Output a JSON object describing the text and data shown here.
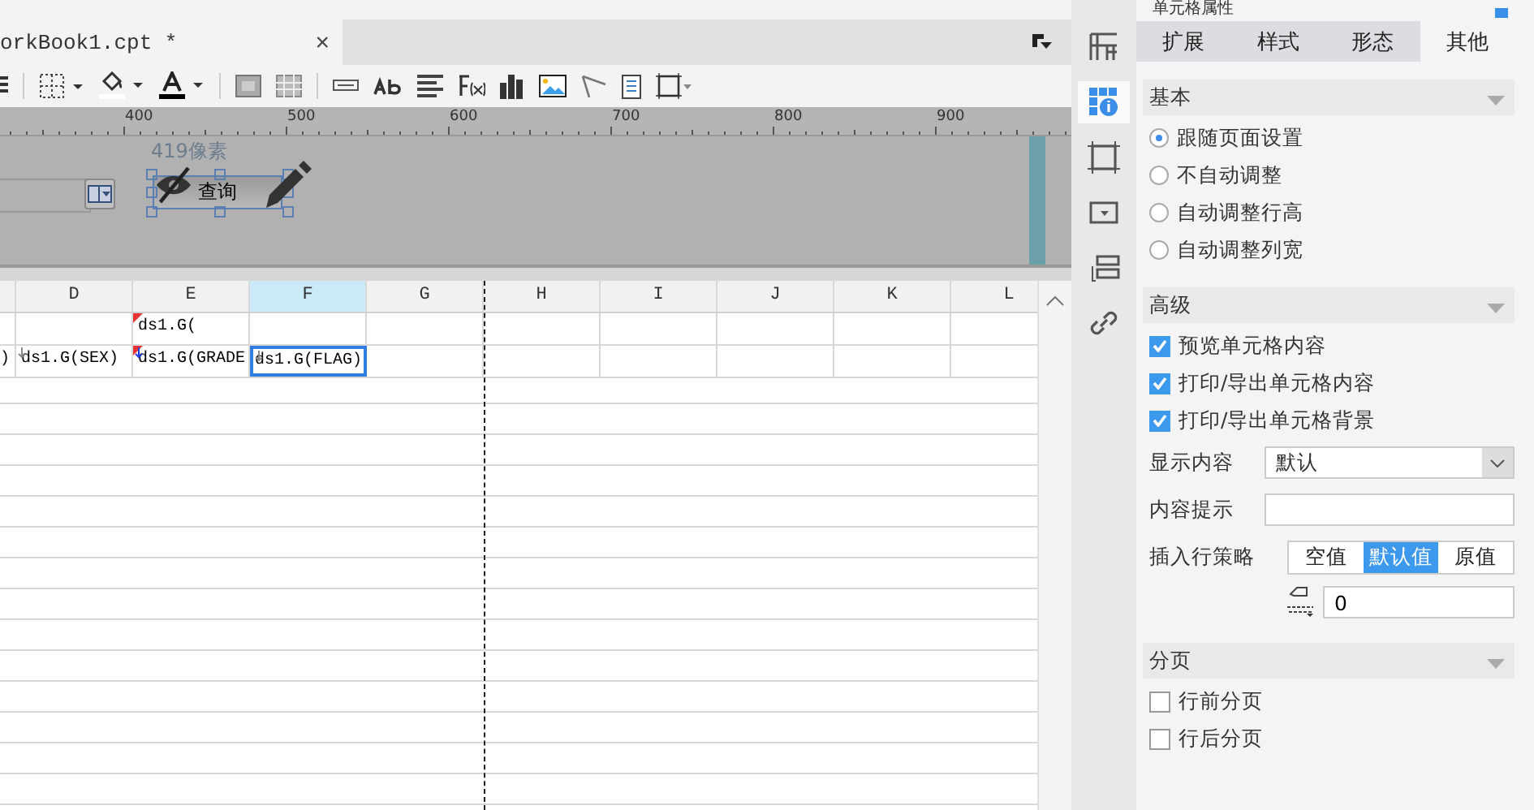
{
  "editor_tab": {
    "title": "orkBook1.cpt *",
    "close": "×"
  },
  "ruler": {
    "labels": [
      "400",
      "500",
      "600",
      "700",
      "800",
      "900"
    ]
  },
  "canvas": {
    "size_label": "419像素",
    "button_label": "查询"
  },
  "grid": {
    "columns": [
      {
        "selected": false
      },
      {
        "label": "D",
        "selected": false
      },
      {
        "label": "E",
        "selected": false
      },
      {
        "label": "F",
        "selected": true
      },
      {
        "label": "G",
        "selected": false
      },
      {
        "label": "H",
        "selected": false
      },
      {
        "label": "I",
        "selected": false
      },
      {
        "label": "J",
        "selected": false
      },
      {
        "label": "K",
        "selected": false
      },
      {
        "label": "L",
        "selected": false
      }
    ],
    "rows": [
      {
        "cells": [
          {
            "selected": false
          },
          {
            "selected": false
          },
          {
            "text": "ds1.G(",
            "kind": "flag",
            "selected": false
          }
        ]
      },
      {
        "cells": [
          {
            "text": ")",
            "selected": false
          },
          {
            "text": "ds1.G(SEX)",
            "kind": "arrow",
            "selected": false
          },
          {
            "text": "ds1.G(GRADE",
            "kind": "flag-arrow",
            "selected": false
          },
          {
            "text": "ds1.G(FLAG)",
            "kind": "arrow",
            "selected": true
          }
        ]
      }
    ]
  },
  "side_icons": [
    {
      "kind": "layout",
      "selected": false
    },
    {
      "kind": "cell-info",
      "selected": true
    },
    {
      "kind": "frame",
      "selected": false
    },
    {
      "kind": "dropdown",
      "selected": false
    },
    {
      "kind": "list",
      "selected": false
    },
    {
      "kind": "link",
      "selected": false
    }
  ],
  "panel": {
    "title": "单元格属性",
    "tabs": [
      {
        "label": "扩展",
        "selected": false
      },
      {
        "label": "样式",
        "selected": false
      },
      {
        "label": "形态",
        "selected": false
      },
      {
        "label": "其他",
        "selected": true
      }
    ],
    "sections": [
      {
        "title": "基本",
        "items": [
          {
            "kind": "radio",
            "label": "跟随页面设置",
            "selected": true
          },
          {
            "kind": "radio",
            "label": "不自动调整",
            "selected": false
          },
          {
            "kind": "radio",
            "label": "自动调整行高",
            "selected": false
          },
          {
            "kind": "radio",
            "label": "自动调整列宽",
            "selected": false
          }
        ]
      },
      {
        "title": "高级",
        "items": [
          {
            "kind": "checkbox",
            "label": "预览单元格内容",
            "checked": true
          },
          {
            "kind": "checkbox",
            "label": "打印/导出单元格内容",
            "checked": true
          },
          {
            "kind": "checkbox",
            "label": "打印/导出单元格背景",
            "checked": true
          },
          {
            "kind": "select",
            "label": "显示内容",
            "value": "默认"
          },
          {
            "kind": "text",
            "label": "内容提示"
          },
          {
            "kind": "segmented",
            "label": "插入行策略",
            "options": [
              {
                "label": "空值",
                "selected": false
              },
              {
                "label": "默认值",
                "selected": true
              },
              {
                "label": "原值",
                "selected": false
              }
            ]
          },
          {
            "kind": "value",
            "value": "0"
          }
        ]
      },
      {
        "title": "分页",
        "items": [
          {
            "kind": "checkbox",
            "label": "行前分页",
            "checked": false
          },
          {
            "kind": "checkbox",
            "label": "行后分页",
            "checked": false
          }
        ]
      }
    ]
  }
}
